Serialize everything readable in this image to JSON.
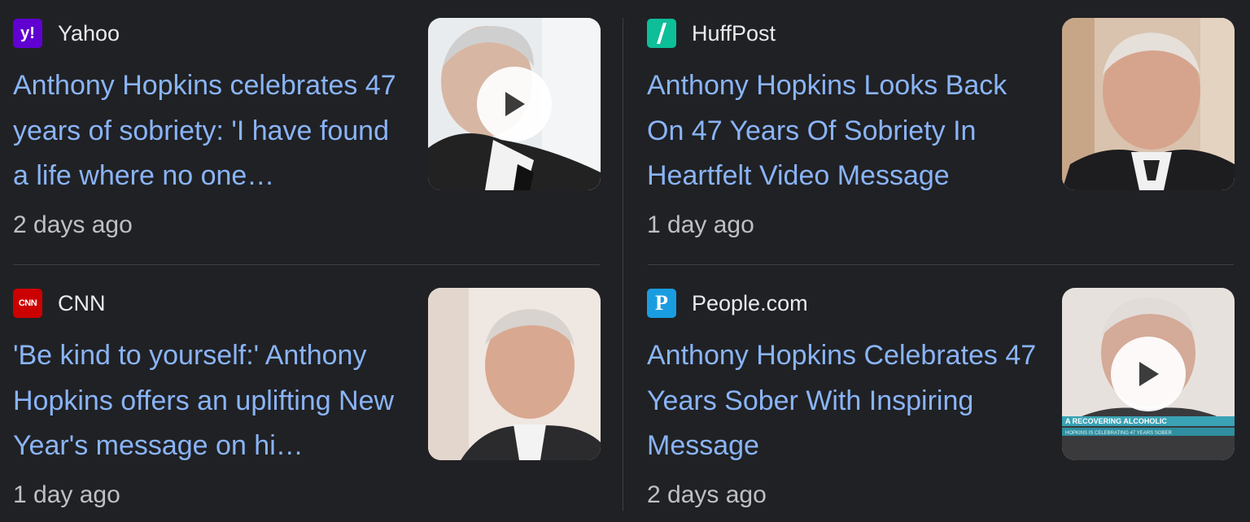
{
  "cards": [
    {
      "source": "Yahoo",
      "favicon_icon": "yahoo-logo-icon",
      "favicon_text": "y!",
      "favicon_color": "#6001d2",
      "headline": "Anthony Hopkins celebrates 47 years of sobriety: 'I have found a life where no one…",
      "time": "2 days ago",
      "has_video": true
    },
    {
      "source": "HuffPost",
      "favicon_icon": "huffpost-logo-icon",
      "favicon_color": "#0dbe98",
      "headline": "Anthony Hopkins Looks Back On 47 Years Of Sobriety In Heartfelt Video Message",
      "time": "1 day ago",
      "has_video": false
    },
    {
      "source": "CNN",
      "favicon_icon": "cnn-logo-icon",
      "favicon_text": "CNN",
      "favicon_color": "#cc0000",
      "headline": "'Be kind to yourself:' Anthony Hopkins offers an uplifting New Year's message on hi…",
      "time": "1 day ago",
      "has_video": false
    },
    {
      "source": "People.com",
      "favicon_icon": "people-logo-icon",
      "favicon_text": "P",
      "favicon_color": "#1a9de0",
      "headline": "Anthony Hopkins Celebrates 47 Years Sober With Inspiring Message",
      "time": "2 days ago",
      "has_video": true
    }
  ],
  "thumbnail_overlay": {
    "line1": "A RECOVERING ALCOHOLIC",
    "line2": "HOPKINS IS CELEBRATING 47 YEARS SOBER"
  },
  "colors": {
    "background": "#202124",
    "headline": "#8ab4f8",
    "source": "#e8eaed",
    "time": "#bdc1c6",
    "divider": "#3c4043"
  }
}
